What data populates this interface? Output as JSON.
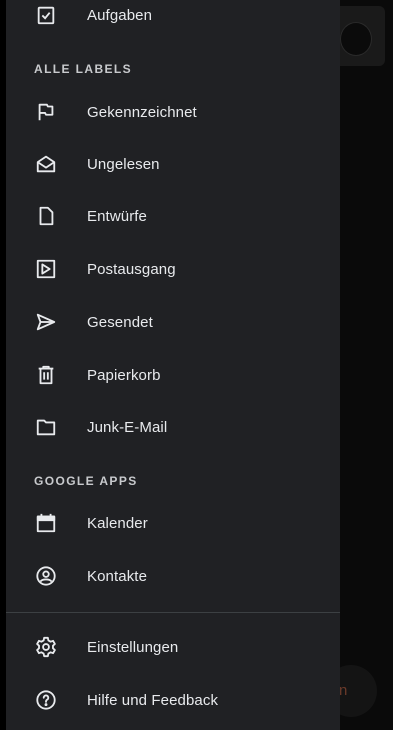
{
  "top_item": {
    "label": "Aufgaben",
    "icon": "tasks-icon"
  },
  "sections": {
    "labels_header": "ALLE LABELS",
    "apps_header": "GOOGLE APPS"
  },
  "labels": [
    {
      "label": "Gekennzeichnet",
      "icon": "flag-icon"
    },
    {
      "label": "Ungelesen",
      "icon": "unread-mail-icon"
    },
    {
      "label": "Entwürfe",
      "icon": "draft-icon"
    },
    {
      "label": "Postausgang",
      "icon": "outbox-icon"
    },
    {
      "label": "Gesendet",
      "icon": "send-icon"
    },
    {
      "label": "Papierkorb",
      "icon": "trash-icon"
    },
    {
      "label": "Junk-E-Mail",
      "icon": "folder-icon"
    }
  ],
  "apps": [
    {
      "label": "Kalender",
      "icon": "calendar-icon"
    },
    {
      "label": "Kontakte",
      "icon": "contacts-icon"
    }
  ],
  "footer": [
    {
      "label": "Einstellungen",
      "icon": "gear-icon"
    },
    {
      "label": "Hilfe und Feedback",
      "icon": "help-icon"
    }
  ],
  "background": {
    "fab_partial_text": "n"
  },
  "colors": {
    "drawer_bg": "#202124",
    "text": "#e8eaed",
    "icon": "#e8eaed"
  }
}
